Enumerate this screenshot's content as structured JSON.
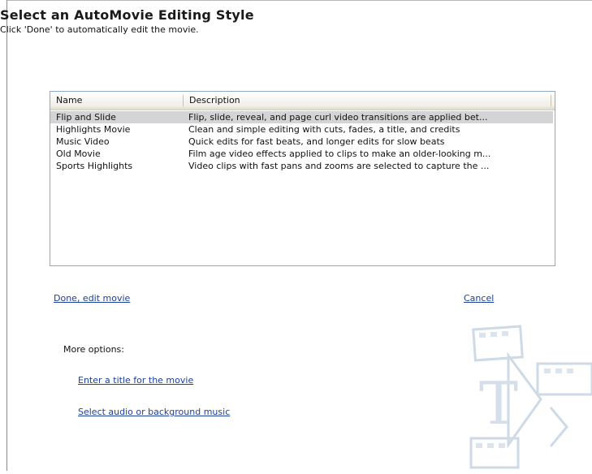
{
  "dialog": {
    "title": "Select an AutoMovie Editing Style",
    "subtitle": "Click 'Done' to automatically edit the movie."
  },
  "list": {
    "columns": [
      "Name",
      "Description"
    ],
    "rows": [
      {
        "name": "Flip and Slide",
        "description": "Flip, slide, reveal, and page curl video transitions are applied bet...",
        "selected": true
      },
      {
        "name": "Highlights Movie",
        "description": "Clean and simple editing with cuts, fades, a title, and credits",
        "selected": false
      },
      {
        "name": "Music Video",
        "description": "Quick edits for fast beats, and longer edits for slow beats",
        "selected": false
      },
      {
        "name": "Old Movie",
        "description": "Film age video effects applied to clips to make an older-looking m...",
        "selected": false
      },
      {
        "name": "Sports Highlights",
        "description": "Video clips with fast pans and zooms are selected to capture the ...",
        "selected": false
      }
    ]
  },
  "actions": {
    "done": "Done, edit movie",
    "cancel": "Cancel"
  },
  "more_options": {
    "label": "More options:",
    "title_link": "Enter a title for the movie",
    "audio_link": "Select audio or background music"
  },
  "colors": {
    "link": "#1b3f9b",
    "selection": "#d4d4d6",
    "list_border": "#8fa7c6",
    "watermark": "#c9d6e4"
  },
  "watermark": {
    "icon": "film-strip-title-icon",
    "glyph": "T"
  }
}
